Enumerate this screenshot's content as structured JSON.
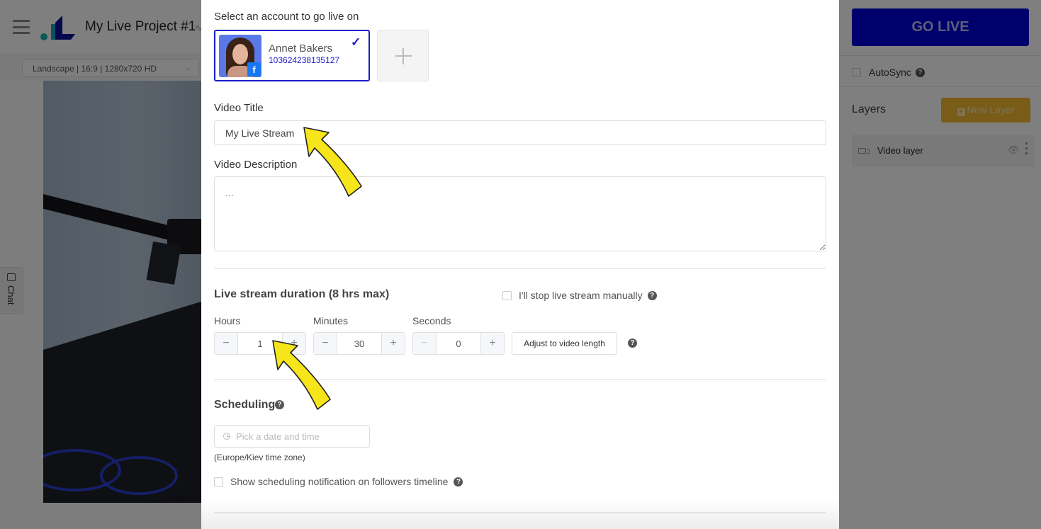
{
  "header": {
    "project_title": "My Live Project #1",
    "format_select": "Landscape | 16:9 | 1280x720 HD"
  },
  "chat_tab": {
    "label": "Chat"
  },
  "right_panel": {
    "go_live_label": "GO LIVE",
    "autosync_label": "AutoSync",
    "autosync_checked": false,
    "layers_title": "Layers",
    "new_layer_label": "New Layer",
    "layers": [
      {
        "name": "Video layer",
        "type": "video",
        "visible": true
      }
    ]
  },
  "modal": {
    "account_section_label": "Select an account to go live on",
    "accounts": [
      {
        "name": "Annet Bakers",
        "id": "103624238135127",
        "platform": "facebook",
        "selected": true
      }
    ],
    "video_title_label": "Video Title",
    "video_title_value": "My Live Stream",
    "video_description_label": "Video Description",
    "video_description_value": "...",
    "duration": {
      "title": "Live stream duration (8 hrs max)",
      "manual_stop_label": "I'll stop live stream manually",
      "manual_stop_checked": false,
      "hours_label": "Hours",
      "hours_value": "1",
      "minutes_label": "Minutes",
      "minutes_value": "30",
      "seconds_label": "Seconds",
      "seconds_value": "0",
      "adjust_label": "Adjust to video length"
    },
    "scheduling": {
      "title": "Scheduling",
      "date_placeholder": "Pick a date and time",
      "timezone_note": "(Europe/Kiev time zone)",
      "notify_label": "Show scheduling notification on followers timeline",
      "notify_checked": false
    }
  },
  "colors": {
    "go_live": "#0000d8",
    "new_layer": "#f0b82e",
    "account_selected_border": "#1a1acc",
    "annotation_arrow": "#f7e51b"
  }
}
